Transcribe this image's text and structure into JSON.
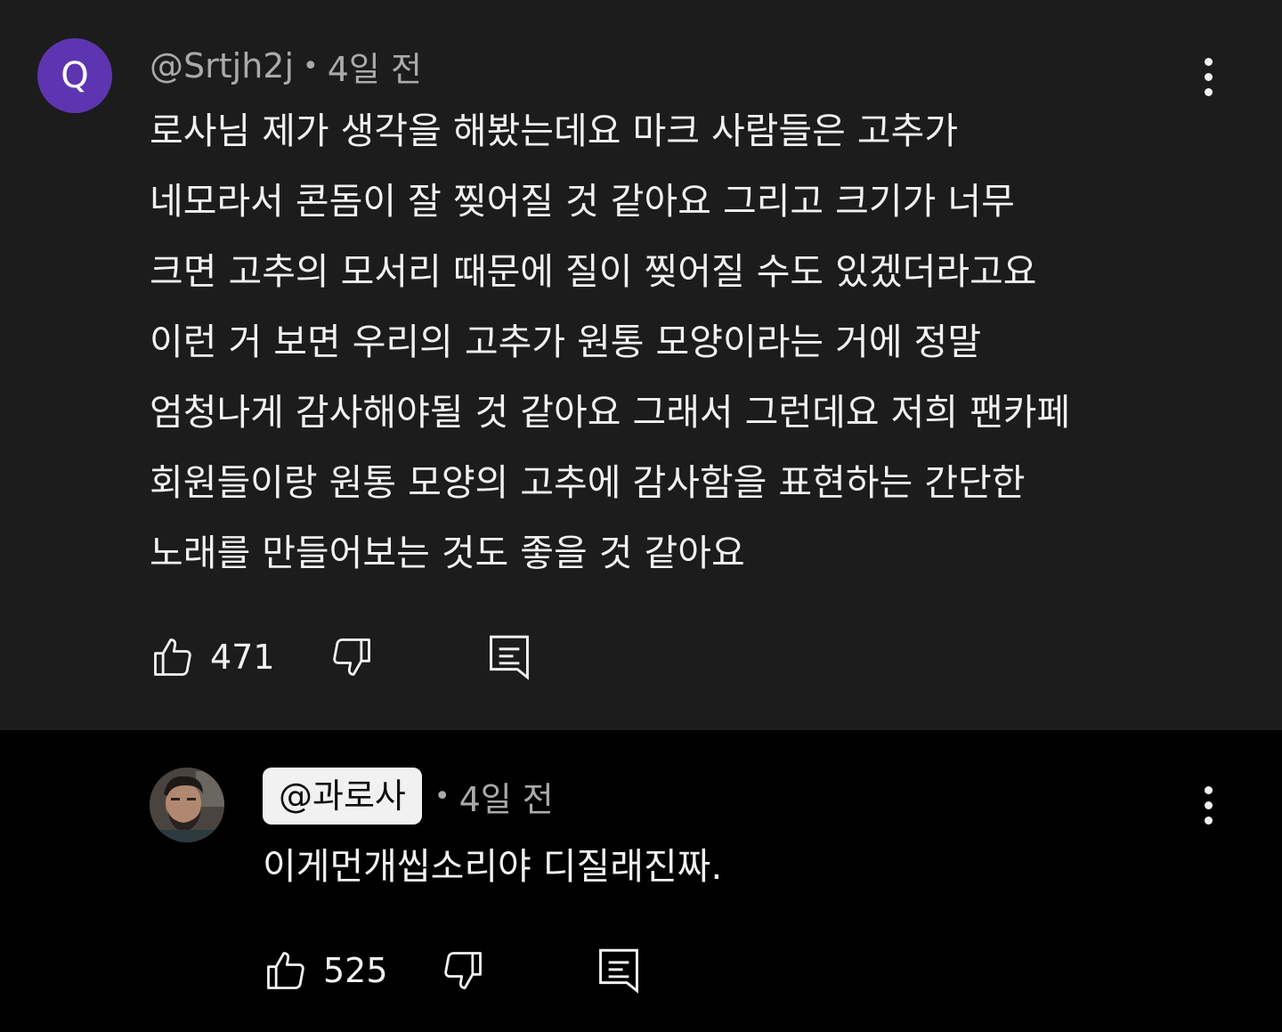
{
  "comment": {
    "avatar_letter": "Q",
    "author": "@Srtjh2j",
    "separator": "•",
    "time": "4일 전",
    "lines": [
      "로사님 제가 생각을 해봤는데요 마크 사람들은 고추가",
      "네모라서 콘돔이 잘 찢어질 것 같아요 그리고 크기가 너무",
      "크면 고추의 모서리 때문에 질이 찢어질 수도 있겠더라고요",
      "이런 거 보면 우리의 고추가 원통 모양이라는 거에 정말",
      "엄청나게 감사해야될 것 같아요 그래서 그런데요 저희 팬카페",
      "회원들이랑 원통 모양의 고추에 감사함을 표현하는 간단한",
      "노래를 만들어보는 것도 좋을 것 같아요"
    ],
    "like_count": "471"
  },
  "reply": {
    "author": "@과로사",
    "separator": "•",
    "time": "4일 전",
    "text": "이게먼개씹소리야 디질래진짜.",
    "like_count": "525"
  },
  "colors": {
    "top_bg": "#1c1c1c",
    "reply_bg": "#000000",
    "avatar_bg": "#5e35b1",
    "meta_text": "#aaaaaa",
    "main_text": "#f1f1f1"
  },
  "icons": {
    "like": "thumbs-up-icon",
    "dislike": "thumbs-down-icon",
    "reply": "reply-comment-icon",
    "menu": "more-vert-icon"
  }
}
